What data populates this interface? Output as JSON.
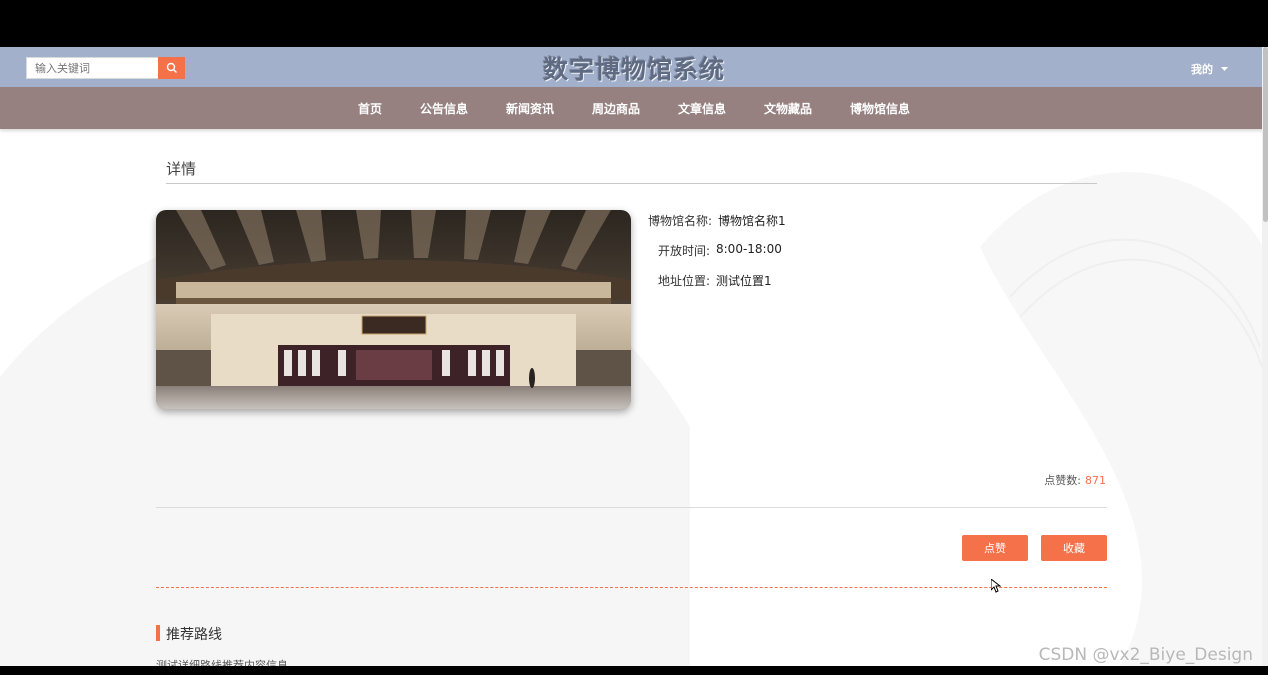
{
  "header": {
    "search_placeholder": "输入关键词",
    "site_title": "数字博物馆系统",
    "user_menu_label": "我的"
  },
  "nav": {
    "items": [
      "首页",
      "公告信息",
      "新闻资讯",
      "周边商品",
      "文章信息",
      "文物藏品",
      "博物馆信息"
    ]
  },
  "detail": {
    "section_title": "详情",
    "fields": [
      {
        "label": "博物馆名称:",
        "value": "博物馆名称1"
      },
      {
        "label": "开放时间:",
        "value": "8:00-18:00"
      },
      {
        "label": "地址位置:",
        "value": "测试位置1"
      }
    ],
    "likes_label": "点赞数:",
    "likes_count": "871",
    "like_button": "点赞",
    "favorite_button": "收藏"
  },
  "route": {
    "title": "推荐路线",
    "content": "测试详细路线推荐内容信息"
  },
  "watermark": "CSDN @vx2_Biye_Design",
  "colors": {
    "topbar": "#a2b0cb",
    "navbar": "#968080",
    "accent": "#f4714a"
  }
}
